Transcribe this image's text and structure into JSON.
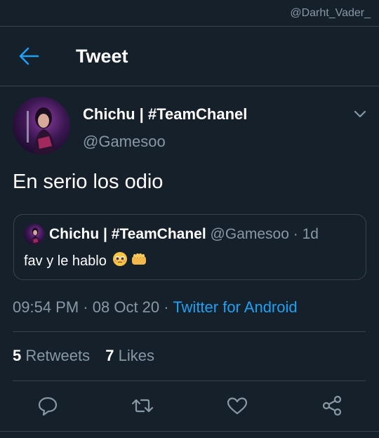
{
  "watermark": "@Darht_Vader_",
  "header": {
    "title": "Tweet",
    "back_icon": "arrow-left-icon"
  },
  "tweet": {
    "author_name": "Chichu | #TeamChanel",
    "author_handle": "@Gamesoo",
    "text": "En serio los odio",
    "quote": {
      "author_name": "Chichu | #TeamChanel",
      "author_handle": "@Gamesoo",
      "age": "· 1d",
      "text": "fav y le hablo",
      "emojis": [
        "pleading-face",
        "fist-bump"
      ]
    },
    "time": "09:54 PM",
    "date": "08 Oct 20",
    "separator": "·",
    "source": "Twitter for Android",
    "retweets": {
      "count": "5",
      "label": "Retweets"
    },
    "likes": {
      "count": "7",
      "label": "Likes"
    }
  },
  "actions": [
    {
      "name": "reply",
      "icon": "comment-icon"
    },
    {
      "name": "retweet",
      "icon": "retweet-icon"
    },
    {
      "name": "like",
      "icon": "heart-icon"
    },
    {
      "name": "share",
      "icon": "share-icon"
    }
  ],
  "colors": {
    "background": "#15202b",
    "accent": "#1da1f2",
    "secondary_text": "#8899a6",
    "border": "#38444d"
  }
}
